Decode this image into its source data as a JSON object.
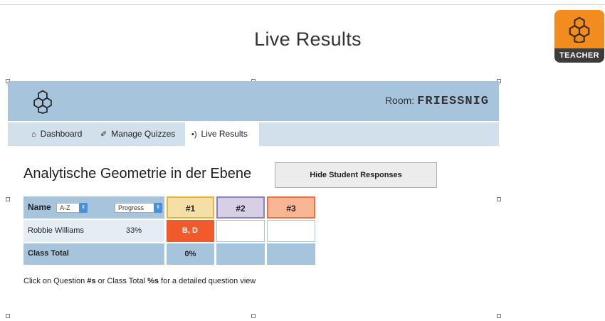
{
  "slide": {
    "title": "Live Results"
  },
  "badge": {
    "label": "TEACHER",
    "icon": "hexagon-cluster-icon",
    "color": "#f28c1e"
  },
  "header": {
    "room_label": "Room:",
    "room_code": "FRIESSNIG",
    "logo_icon": "hexagon-cluster-icon",
    "bg_color": "#a7c4dd"
  },
  "nav": {
    "items": [
      {
        "label": "Dashboard",
        "icon": "home-icon",
        "active": false
      },
      {
        "label": "Manage Quizzes",
        "icon": "wrench-icon",
        "active": false
      },
      {
        "label": "Live Results",
        "icon": "broadcast-icon",
        "active": true
      }
    ]
  },
  "quiz": {
    "title": "Analytische Geometrie in der Ebene",
    "hide_button": "Hide Student Responses"
  },
  "table": {
    "name_header": "Name",
    "sort_select": "A-Z",
    "progress_select": "Progress",
    "questions": [
      {
        "label": "#1",
        "color": "#f5dfa6",
        "border": "#e8b43a"
      },
      {
        "label": "#2",
        "color": "#d6cfe6",
        "border": "#8e7fc0"
      },
      {
        "label": "#3",
        "color": "#f8b694",
        "border": "#e8704a"
      }
    ],
    "rows": [
      {
        "name": "Robbie Williams",
        "progress": "33%",
        "answers": [
          "B, D",
          "",
          ""
        ],
        "answer_colors": [
          "#f15a2b",
          "#ffffff",
          "#ffffff"
        ]
      }
    ],
    "total": {
      "label": "Class Total",
      "values": [
        "0%",
        "",
        ""
      ]
    }
  },
  "hint": {
    "part1": "Click on Question ",
    "q": "#s",
    "part2": " or Class Total ",
    "pct": "%s",
    "part3": " for a detailed question view"
  }
}
